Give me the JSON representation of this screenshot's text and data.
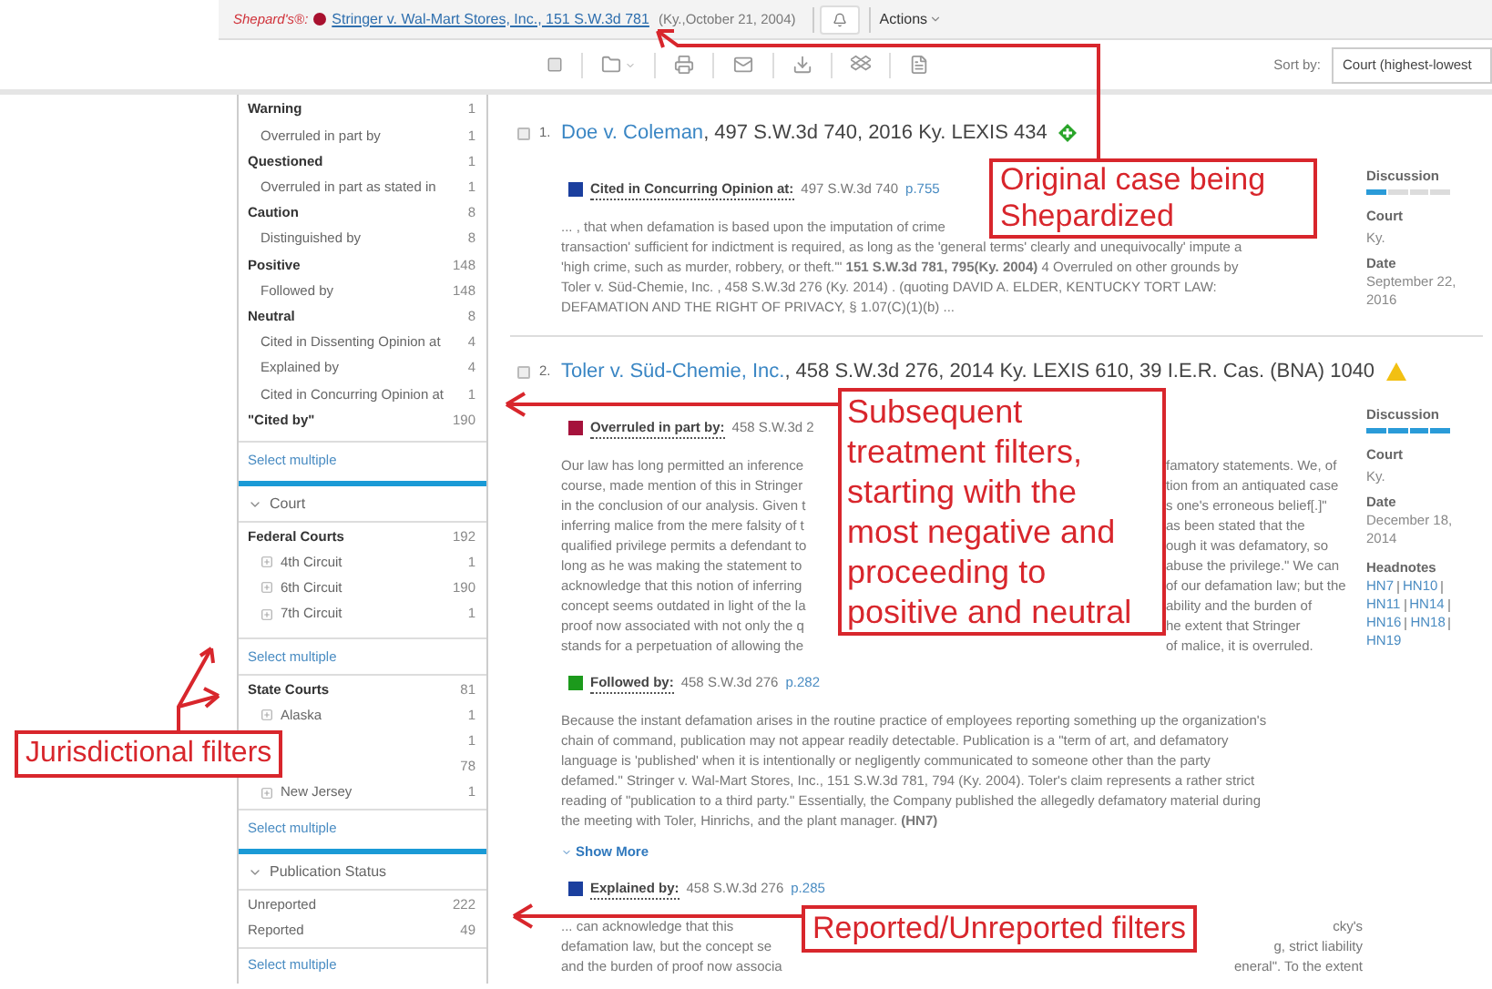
{
  "header": {
    "brand": "Shepard's®:",
    "case_link": "Stringer v. Wal-Mart Stores, Inc., 151 S.W.3d 781",
    "case_info": "(Ky.,October 21, 2004)",
    "actions": "Actions"
  },
  "toolbar": {
    "sort_label": "Sort by:",
    "sort_value": "Court (highest-lowest"
  },
  "sidebar": {
    "treatments": [
      {
        "label": "Warning",
        "count": "1",
        "children": [
          {
            "label": "Overruled in part by",
            "count": "1"
          }
        ]
      },
      {
        "label": "Questioned",
        "count": "1",
        "children": [
          {
            "label": "Overruled in part as stated in",
            "count": "1"
          }
        ]
      },
      {
        "label": "Caution",
        "count": "8",
        "children": [
          {
            "label": "Distinguished by",
            "count": "8"
          }
        ]
      },
      {
        "label": "Positive",
        "count": "148",
        "children": [
          {
            "label": "Followed by",
            "count": "148"
          }
        ]
      },
      {
        "label": "Neutral",
        "count": "8",
        "children": [
          {
            "label": "Cited in Dissenting Opinion at",
            "count": "4"
          },
          {
            "label": "Explained by",
            "count": "4"
          },
          {
            "label": "Cited in Concurring Opinion at",
            "count": "1"
          }
        ]
      },
      {
        "label": "\"Cited by\"",
        "count": "190"
      }
    ],
    "treatments_select": "Select multiple",
    "court": {
      "heading": "Court",
      "expanded": true,
      "groups": [
        {
          "label": "Federal Courts",
          "count": "192",
          "select": "Select multiple",
          "children": [
            {
              "label": "4th Circuit",
              "count": "1"
            },
            {
              "label": "6th Circuit",
              "count": "190"
            },
            {
              "label": "7th Circuit",
              "count": "1"
            }
          ]
        },
        {
          "label": "State Courts",
          "count": "81",
          "select": "Select multiple",
          "children": [
            {
              "label": "Alaska",
              "count": "1"
            },
            {
              "count": "1"
            },
            {
              "count": "78"
            },
            {
              "label": "New Jersey",
              "count": "1"
            }
          ]
        }
      ]
    },
    "publication": {
      "heading": "Publication Status",
      "expanded": true,
      "items": [
        {
          "label": "Unreported",
          "count": "222"
        },
        {
          "label": "Reported",
          "count": "49"
        }
      ],
      "select": "Select multiple"
    }
  },
  "results": [
    {
      "number": "1.",
      "checked": false,
      "title": "Doe v. Coleman",
      "citation": ", 497 S.W.3d 740, 2016 Ky. LEXIS 434",
      "signal": {
        "kind": "positive"
      },
      "treatments": [
        {
          "label": "Cited in Concurring Opinion at:",
          "color": "#1b3f9e",
          "cite": "497 S.W.3d 740",
          "page": "p.755",
          "lines": [
            {
              "left": "... , that when defamation is based upon the imputation of crime"
            },
            {
              "left": "transaction' sufficient for indictment is required, as long as the 'general terms' clearly and unequivocally' impute a"
            },
            {
              "left": "'high crime, such as murder, robbery, or theft.'\" **151 S.W.3d 781, 795(Ky. 2004)** 4 Overruled on other grounds by"
            },
            {
              "left": "Toler v. Süd-Chemie, Inc. , 458 S.W.3d 276 (Ky. 2014) . (quoting DAVID A. ELDER, KENTUCKY TORT LAW:"
            },
            {
              "left": "DEFAMATION AND THE RIGHT OF PRIVACY, § 1.07(C)(1)(b) ..."
            }
          ]
        }
      ],
      "info": {
        "discussion_label": "Discussion",
        "level": 0.25,
        "court_label": "Court",
        "court": "Ky.",
        "date_label": "Date",
        "date": "September 22, 2016"
      }
    },
    {
      "number": "2.",
      "checked": false,
      "title": "Toler v. Süd-Chemie, Inc.",
      "citation": ", 458 S.W.3d 276, 2014 Ky. LEXIS 610, 39 I.E.R. Cas. (BNA) 1040",
      "signal": {
        "kind": "caution"
      },
      "treatments": [
        {
          "label": "Overruled in part by:",
          "color": "#a5123c",
          "cite": "458 S.W.3d 2",
          "lines": [
            {
              "left": "Our law has long permitted an inference",
              "right": "famatory statements. We, of"
            },
            {
              "left": "course, made mention of this in Stringer",
              "right": "tion from an antiquated case"
            },
            {
              "left": "in the conclusion of our analysis. Given t",
              "right": "s one's erroneous belief[.]\""
            },
            {
              "left": "inferring malice from the mere falsity of t",
              "right": "as been stated that the"
            },
            {
              "left": "qualified privilege permits a defendant to",
              "right": "ough it was defamatory, so"
            },
            {
              "left": "long as he was making the statement to",
              "right": "abuse the privilege.\" We can"
            },
            {
              "left": "acknowledge that this notion of inferring",
              "right": "of our defamation law; but the"
            },
            {
              "left": "concept seems outdated in light of the la",
              "right": "ability and the burden of"
            },
            {
              "left": "proof now associated with not only the q",
              "right": "he extent that Stringer"
            },
            {
              "left": "stands for a perpetuation of allowing the",
              "right": "of malice, it is overruled."
            }
          ]
        },
        {
          "label": "Followed by:",
          "color": "#1c9a1c",
          "cite": "458 S.W.3d 276",
          "page": "p.282",
          "lines": [
            {
              "left": "Because the instant defamation arises in the routine practice of employees reporting something up the organization's"
            },
            {
              "left": "chain of command, publication may not appear readily detectable. Publication is a \"term of art, and defamatory"
            },
            {
              "left": "language is 'published' when it is intentionally or negligently communicated to someone other than the party"
            },
            {
              "left": "defamed.\" Stringer v. Wal-Mart Stores, Inc., 151 S.W.3d 781, 794 (Ky. 2004). Toler's claim represents a rather strict"
            },
            {
              "left": "reading of \"publication to a third party.\" Essentially, the Company published the allegedly defamatory material during"
            },
            {
              "left": "the meeting with Toler, Hinrichs, and the plant manager. **(HN7)**"
            }
          ],
          "show_more": "Show More"
        },
        {
          "label": "Explained by:",
          "color": "#1b3f9e",
          "cite": "458 S.W.3d 276",
          "page": "p.285",
          "lines": [
            {
              "left": "... can acknowledge that this",
              "right": "cky's"
            },
            {
              "left": "defamation law, but the concept se",
              "right": "g, strict liability"
            },
            {
              "left": "and the burden of proof now associa",
              "right": "eneral\". To the extent"
            }
          ]
        }
      ],
      "info": {
        "discussion_label": "Discussion",
        "level": 1,
        "court_label": "Court",
        "court": "Ky.",
        "date_label": "Date",
        "date": "December 18, 2014",
        "headnotes_label": "Headnotes",
        "headnotes": [
          "HN7",
          "HN10",
          "HN11",
          "HN14",
          "HN16",
          "HN18",
          "HN19"
        ]
      }
    }
  ],
  "annotations": [
    {
      "text": "Original case being Shepardized"
    },
    {
      "text": "Subsequent treatment filters, starting with the most negative and proceeding to positive and neutral"
    },
    {
      "text": "Jurisdictional filters"
    },
    {
      "text": "Reported/Unreported filters"
    }
  ]
}
